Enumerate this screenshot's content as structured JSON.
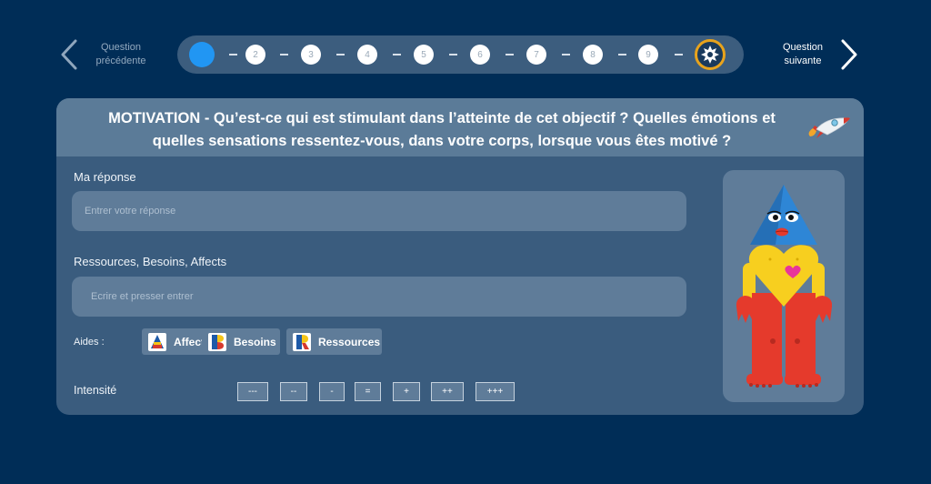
{
  "nav": {
    "prev_label": "Question précédente",
    "next_label": "Question suivante"
  },
  "stepper": {
    "current_step": 1,
    "steps": [
      "",
      "2",
      "3",
      "4",
      "5",
      "6",
      "7",
      "8",
      "9"
    ],
    "final_icon": "burst-star-icon"
  },
  "question": {
    "text": "MOTIVATION - Qu’est-ce qui est stimulant dans l’atteinte de cet objectif ? Quelles émotions et quelles sensations ressentez-vous, dans votre corps, lorsque vous êtes motivé ?",
    "icon": "rocket-icon"
  },
  "answer": {
    "label": "Ma réponse",
    "placeholder": "Entrer votre réponse"
  },
  "resources": {
    "label": "Ressources, Besoins, Affects",
    "placeholder": "Ecrire et presser entrer"
  },
  "aides": {
    "label": "Aides :",
    "buttons": [
      "Affects",
      "Besoins",
      "Ressources"
    ]
  },
  "intensity": {
    "label": "Intensité",
    "options": [
      "---",
      "--",
      "-",
      "=",
      "+",
      "++",
      "+++"
    ]
  },
  "colors": {
    "background": "#002d57",
    "card": "#3a5c7e",
    "active_step": "#2196f3",
    "final_step_ring": "#e8a31c"
  }
}
